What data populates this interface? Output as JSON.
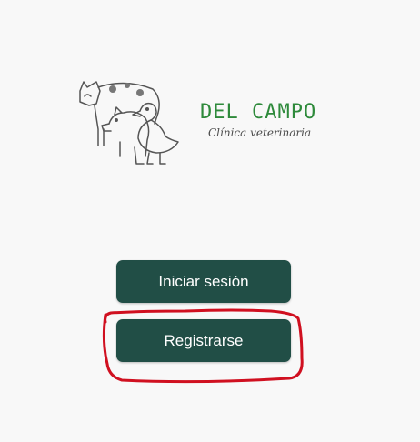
{
  "brand": {
    "name": "DEL CAMPO",
    "tagline": "Clínica veterinaria",
    "logo_icon": "farm-animals-logo"
  },
  "actions": {
    "login_label": "Iniciar sesión",
    "register_label": "Registrarse"
  },
  "colors": {
    "background": "#f8f8f8",
    "button": "#214e46",
    "button_text": "#ffffff",
    "brand_green": "#2e8a3b",
    "annotation_red": "#d01020"
  }
}
